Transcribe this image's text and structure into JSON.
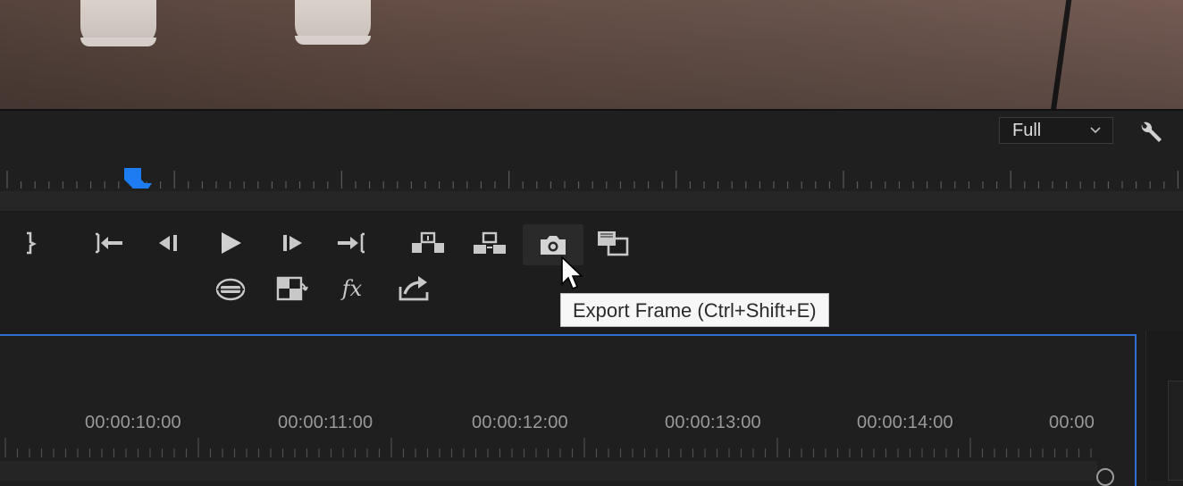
{
  "program_monitor": {
    "zoom_level": "Full",
    "zoom_chevron": "⌵",
    "settings_icon": "wrench-icon"
  },
  "transport": {
    "top_row": [
      {
        "name": "mark-out",
        "icon": "mark-out-icon"
      },
      {
        "name": "go-to-in",
        "icon": "go-to-in-icon"
      },
      {
        "name": "step-back",
        "icon": "step-back-icon"
      },
      {
        "name": "play",
        "icon": "play-icon"
      },
      {
        "name": "step-forward",
        "icon": "step-forward-icon"
      },
      {
        "name": "go-to-out",
        "icon": "go-to-out-icon"
      },
      {
        "name": "lift",
        "icon": "lift-icon"
      },
      {
        "name": "extract",
        "icon": "extract-icon"
      },
      {
        "name": "export-frame",
        "icon": "camera-icon"
      },
      {
        "name": "comparison-view",
        "icon": "comparison-view-icon"
      }
    ],
    "bottom_row": [
      {
        "name": "vr-video",
        "icon": "vr-headset-icon"
      },
      {
        "name": "toggle-proxies",
        "icon": "proxy-toggle-icon"
      },
      {
        "name": "global-fx-mute",
        "icon": "fx-icon"
      },
      {
        "name": "quick-export",
        "icon": "export-icon"
      }
    ],
    "fx_label": "fx"
  },
  "tooltip": {
    "text": "Export Frame (Ctrl+Shift+E)"
  },
  "timeline": {
    "timecodes": [
      "00:00:10:00",
      "00:00:11:00",
      "00:00:12:00",
      "00:00:13:00",
      "00:00:14:00",
      "00:00"
    ]
  },
  "colors": {
    "accent": "#2d6fd2",
    "playhead": "#1d7cf2",
    "panel_bg": "#1d1d1d",
    "tooltip_bg": "#f7f7f7"
  }
}
